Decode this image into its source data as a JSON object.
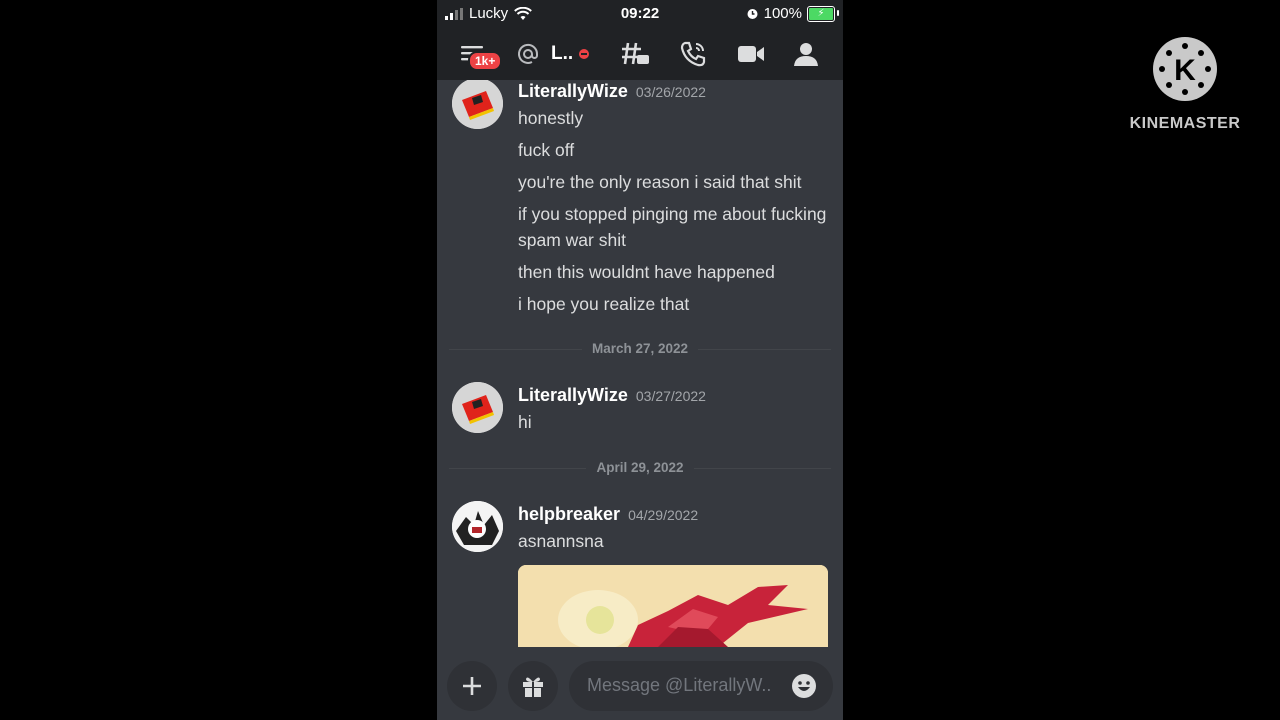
{
  "status_bar": {
    "carrier": "Lucky",
    "time": "09:22",
    "battery": "100%"
  },
  "toolbar": {
    "unread_badge": "1k+",
    "channel_name": "L..",
    "icons": [
      "menu-icon",
      "at-icon",
      "threads-icon",
      "call-icon",
      "video-icon",
      "members-icon"
    ]
  },
  "messages": [
    {
      "author": "LiterallyWize",
      "timestamp": "03/26/2022",
      "lines": [
        "honestly",
        "fuck off",
        "you're the only reason i said that shit",
        "if you stopped pinging me about fucking spam war shit",
        "then this wouldnt have happened",
        "i hope you realize that"
      ]
    },
    {
      "divider": "March 27, 2022"
    },
    {
      "author": "LiterallyWize",
      "timestamp": "03/27/2022",
      "lines": [
        "hi"
      ]
    },
    {
      "divider": "April 29, 2022"
    },
    {
      "author": "helpbreaker",
      "timestamp": "04/29/2022",
      "lines": [
        "asnannsna"
      ]
    }
  ],
  "composer": {
    "placeholder": "Message @LiterallyW.."
  },
  "watermark": {
    "label": "KINEMASTER",
    "letter": "K"
  },
  "colors": {
    "background": "#36393f",
    "header": "#202225",
    "badge": "#ed4245",
    "text": "#dcddde"
  }
}
